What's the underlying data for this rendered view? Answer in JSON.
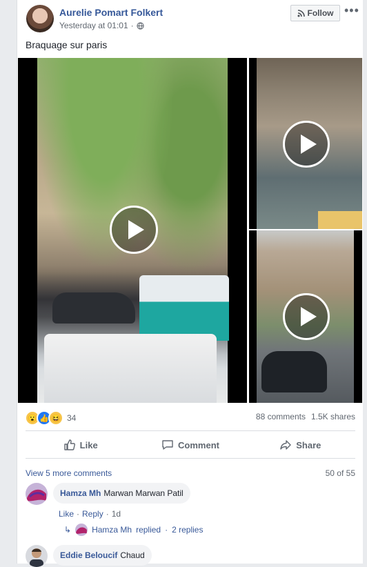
{
  "post": {
    "author": "Aurelie Pomart Folkert",
    "timestamp": "Yesterday at 01:01",
    "privacy_icon": "globe-icon",
    "follow_label": "Follow",
    "more_icon": "•••",
    "text": "Braquage sur paris"
  },
  "reactions": {
    "icons": [
      "wow",
      "like",
      "haha"
    ],
    "count": "34",
    "comments": "88 comments",
    "shares": "1.5K shares"
  },
  "actions": {
    "like": "Like",
    "comment": "Comment",
    "share": "Share"
  },
  "comments": {
    "view_more": "View 5 more comments",
    "pager": "50 of 55",
    "items": [
      {
        "name": "Hamza Mh",
        "text": "Marwan Marwan Patil",
        "like": "Like",
        "reply": "Reply",
        "age": "1d",
        "reply_summary_name": "Hamza Mh",
        "reply_summary_text": "replied",
        "reply_summary_count": "2 replies"
      },
      {
        "name": "Eddie Beloucif",
        "text": "Chaud"
      }
    ]
  },
  "colors": {
    "link": "#385898",
    "author": "#365899",
    "background": "#e9ebee",
    "like_blue": "#2078f4"
  }
}
